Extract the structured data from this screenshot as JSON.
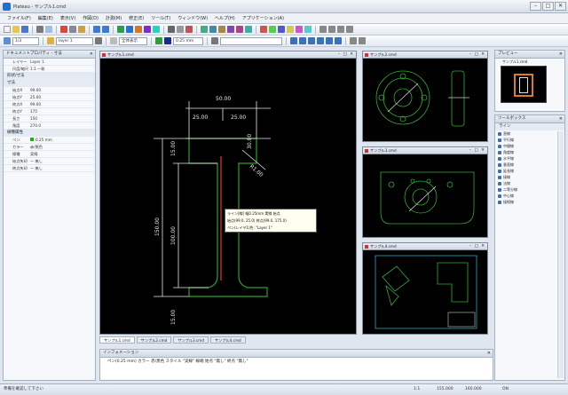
{
  "window": {
    "title": "Plateau - サンプル1.cmd",
    "min": "–",
    "max": "□",
    "close": "✕"
  },
  "menu": [
    "ファイル(F)",
    "編集(E)",
    "表示(V)",
    "作図(D)",
    "計測(M)",
    "修正(E)",
    "ツール(T)",
    "ウィンドウ(W)",
    "ヘルプ(H)",
    "アプリケーション(A)"
  ],
  "toolbar2": {
    "layer_combo": "1/3",
    "view_combo": "layer 1",
    "scale_combo": "全体表示",
    "width_combo": "0.25 mm"
  },
  "property_panel": {
    "title": "ドキュメントプロパティ - 寸法",
    "rows": [
      {
        "k": "レイヤー",
        "v": "Layer 1"
      },
      {
        "k": "尺度/縮尺比",
        "v": "1:1 一致"
      }
    ],
    "cat1": "形状/寸法",
    "cat2": "寸法",
    "rows2": [
      {
        "k": "始点X",
        "v": "99.00"
      },
      {
        "k": "始点Y",
        "v": "25.00"
      },
      {
        "k": "終点X",
        "v": "99.00"
      },
      {
        "k": "終点Y",
        "v": "175"
      },
      {
        "k": "長さ",
        "v": "150"
      },
      {
        "k": "角度",
        "v": "270.0"
      }
    ],
    "cat3": "線種属性",
    "rows3": [
      {
        "k": "ペン",
        "v": "0.25 mm"
      },
      {
        "k": "カラー",
        "v": "赤/黒色"
      },
      {
        "k": "線種",
        "v": "実線"
      },
      {
        "k": "始点矢印",
        "v": "ー 無し"
      },
      {
        "k": "終点矢印",
        "v": "ー 無し"
      }
    ]
  },
  "main_doc": {
    "title": "サンプル1.cmd",
    "dims": {
      "top_width": "50.00",
      "left": "25.00",
      "right": "25.00",
      "height": "150.00",
      "inner": "100.00",
      "web": "30.00",
      "top_flange": "15.00",
      "bottom_flange": "15.00",
      "leader": "R1.00"
    },
    "tooltip": [
      "ライン[線] 幅0.25mm 実線 始点",
      "始点(99.0, 25.0) 終点(99.0, 175.0)",
      "ペン(レイヤ1)色: \"Layer 1\""
    ]
  },
  "thumb_docs": [
    {
      "title": "サンプル2.cmd"
    },
    {
      "title": "サンプル3.cmd"
    },
    {
      "title": "サンプル4.cmd"
    }
  ],
  "doc_tabs": [
    "サンプル1.cmd",
    "サンプル2.cmd",
    "サンプル3.cmd",
    "サンプル4.cmd"
  ],
  "info_panel": {
    "title": "インフォメーション",
    "text": "ペン(0.25 mm) カラー 赤/黒色 スタイル \"実線\" 線端 始点 \"無し\" 終点 \"無し\""
  },
  "preview_panel": {
    "title": "プレビュー",
    "caption": "サンプル1.cmd"
  },
  "tools_panel": {
    "title": "ツールボックス",
    "subtitle": "ライン",
    "items": [
      "直線",
      "平行線",
      "中間線",
      "角度線",
      "水平線",
      "垂直線",
      "延長線",
      "接線",
      "法線",
      "二等分線",
      "中心線",
      "接続線"
    ]
  },
  "status": {
    "left": "準備を確認して下さい",
    "coords": "1:1",
    "x": "155.000",
    "y": "160.000",
    "mode": "ON"
  }
}
